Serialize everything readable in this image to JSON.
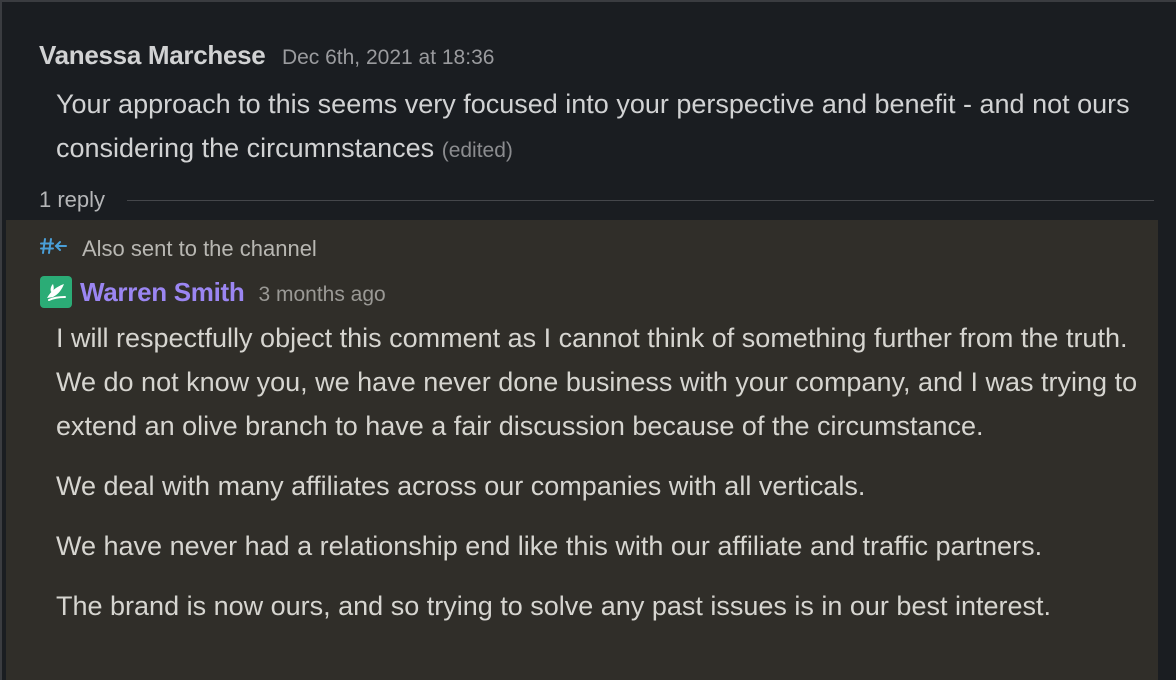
{
  "parent_message": {
    "author": "Vanessa Marchese",
    "timestamp": "Dec 6th, 2021 at 18:36",
    "text": "Your approach to this seems very focused into your perspective and benefit - and not ours considering the circumnstances",
    "edited_label": "(edited)",
    "reply_count": "1 reply"
  },
  "reply_message": {
    "also_sent_icon": "channel-broadcast-icon",
    "also_sent_label": "Also sent to the channel",
    "avatar_icon": "leaf-logo-icon",
    "author": "Warren Smith",
    "timestamp": "3 months ago",
    "paragraphs": [
      "I will respectfully object this comment as I cannot think of something further from the truth. We do not know you, we have never done business with your company, and I was trying to extend an olive branch to have a fair discussion because of the circumstance.",
      "We deal with many affiliates across our companies with all verticals.",
      "We have never had a relationship end like this with our affiliate and traffic partners.",
      "The brand is now ours, and so trying to solve any past issues is in our best interest."
    ]
  },
  "colors": {
    "parent_background": "#1a1d21",
    "reply_background": "#302e29",
    "reply_author": "#9b86f2",
    "channel_icon": "#4a9fd8",
    "avatar": "#2bac76"
  }
}
